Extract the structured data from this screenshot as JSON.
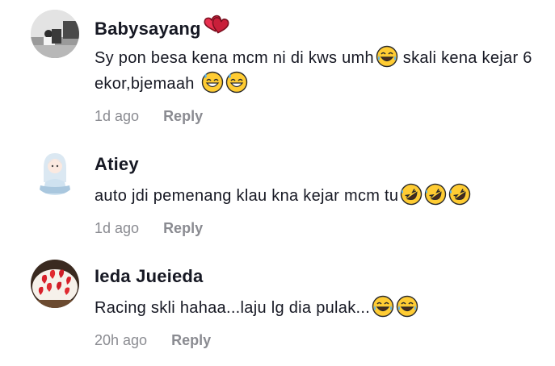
{
  "comments": [
    {
      "username": "Babysayang",
      "username_emoji": "two-hearts-icon",
      "text_parts": [
        "Sy pon besa kena mcm ni di kws umh",
        " skali kena kejar 6 ekor,bjemaah "
      ],
      "emojis": [
        "face-with-tears-of-joy-icon",
        "grinning-sweat-face-icon",
        "grinning-sweat-face-icon"
      ],
      "time": "1d ago",
      "reply_label": "Reply"
    },
    {
      "username": "Atiey",
      "text_parts": [
        "auto jdi pemenang klau kna kejar mcm tu"
      ],
      "emojis": [
        "rolling-on-floor-laughing-icon",
        "rolling-on-floor-laughing-icon",
        "rolling-on-floor-laughing-icon"
      ],
      "time": "1d ago",
      "reply_label": "Reply"
    },
    {
      "username": "Ieda Jueieda",
      "text_parts": [
        "Racing skli hahaa...laju lg dia pulak..."
      ],
      "emojis": [
        "face-with-tears-of-joy-icon",
        "face-with-tears-of-joy-icon"
      ],
      "time": "20h ago",
      "reply_label": "Reply"
    }
  ]
}
